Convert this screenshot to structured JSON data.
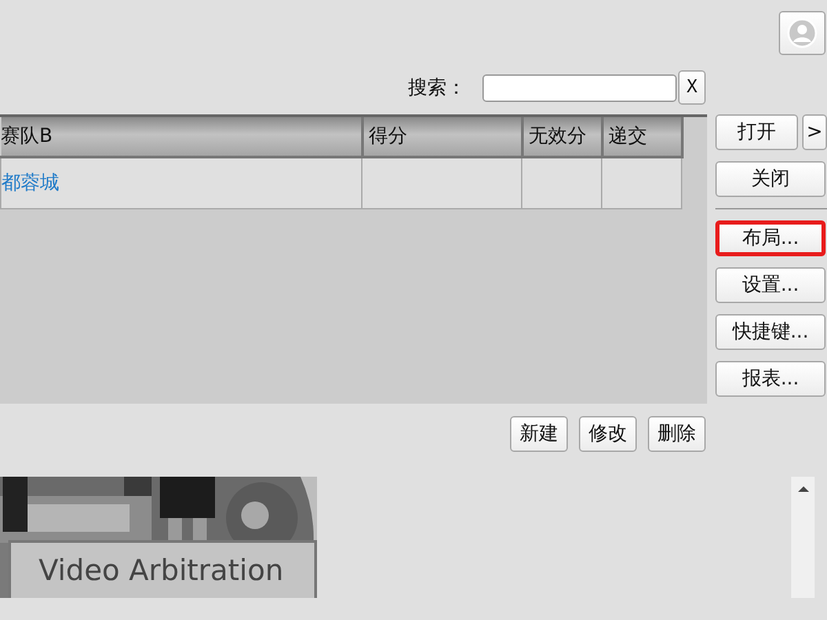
{
  "search": {
    "label": "搜索：",
    "clear": "X"
  },
  "table": {
    "columns": [
      "赛队B",
      "得分",
      "无效分",
      "递交"
    ],
    "rows": [
      [
        "都蓉城",
        "",
        "",
        ""
      ]
    ]
  },
  "side_buttons": [
    {
      "label": "打开",
      "highlighted": false
    },
    {
      "label": "关闭",
      "highlighted": false
    },
    {
      "label": "布局...",
      "highlighted": true
    },
    {
      "label": "设置...",
      "highlighted": false
    },
    {
      "label": "快捷键...",
      "highlighted": false
    },
    {
      "label": "报表...",
      "highlighted": false
    }
  ],
  "expand_button": ">",
  "bottom_buttons": [
    "新建",
    "修改",
    "删除"
  ],
  "banner": {
    "kind": "picture",
    "caption": "Video Arbitration"
  }
}
